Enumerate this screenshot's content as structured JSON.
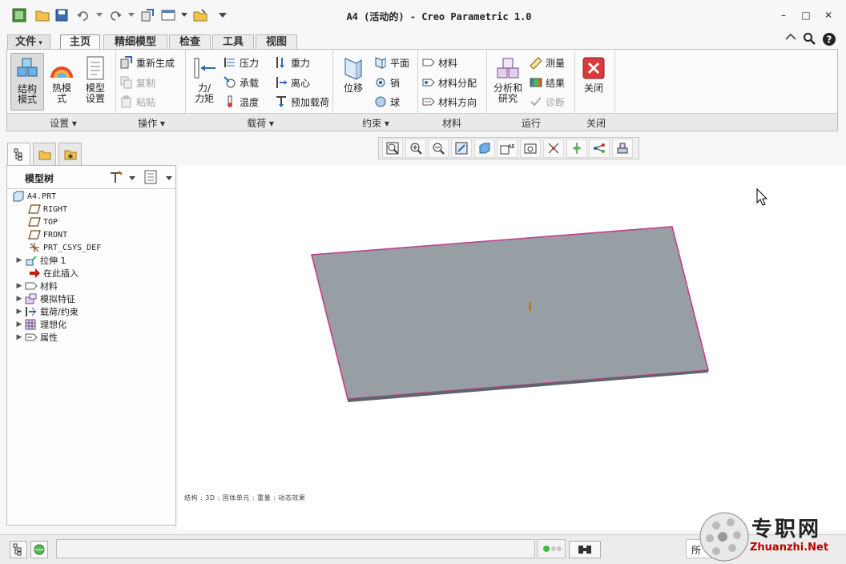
{
  "window": {
    "title": "A4 (活动的) - Creo Parametric 1.0",
    "controls": [
      "–",
      "□",
      "✕"
    ]
  },
  "quick_access": {
    "icons": [
      "app-icon",
      "open-icon",
      "save-icon",
      "undo-icon",
      "redo-icon",
      "regenerate-icon",
      "windows-icon",
      "close-window-icon",
      "customize-icon"
    ]
  },
  "tabs": [
    {
      "label": "文件",
      "has_dropdown": true
    },
    {
      "label": "主页",
      "active": true
    },
    {
      "label": "精细模型"
    },
    {
      "label": "检查"
    },
    {
      "label": "工具"
    },
    {
      "label": "视图"
    }
  ],
  "ribbon": {
    "groups": {
      "setup": "设置",
      "operations": "操作",
      "loads": "载荷",
      "constraints": "约束",
      "materials": "材料",
      "run": "运行",
      "close": "关闭"
    },
    "setup": {
      "structure_mode": "结构\n模式",
      "thermal_mode": "热模\n式",
      "model_setup": "模型\n设置"
    },
    "operations": {
      "regenerate": "重新生成",
      "copy": "复制",
      "paste": "粘贴"
    },
    "loads": {
      "force_moment": "力/\n力矩",
      "pressure": "压力",
      "bearing": "承载",
      "temperature": "温度",
      "gravity": "重力",
      "centrifugal": "离心",
      "preload": "预加载荷"
    },
    "constraints": {
      "displacement": "位移",
      "planar": "平面",
      "pin": "销",
      "ball": "球"
    },
    "materials": {
      "material": "材料",
      "material_assignment": "材料分配",
      "material_orientation": "材料方向"
    },
    "run": {
      "analysis": "分析和\n研究",
      "measure": "测量",
      "results": "结果",
      "diagnostics": "诊断"
    },
    "close": {
      "close": "关闭"
    }
  },
  "model_tree": {
    "title": "模型树",
    "items": [
      {
        "label": "A4.PRT",
        "icon": "part-icon",
        "level": 0
      },
      {
        "label": "RIGHT",
        "icon": "datum-plane-icon",
        "level": 1
      },
      {
        "label": "TOP",
        "icon": "datum-plane-icon",
        "level": 1
      },
      {
        "label": "FRONT",
        "icon": "datum-plane-icon",
        "level": 1
      },
      {
        "label": "PRT_CSYS_DEF",
        "icon": "csys-icon",
        "level": 1
      },
      {
        "label": "拉伸 1",
        "icon": "extrude-icon",
        "level": 1,
        "expandable": true
      },
      {
        "label": "在此插入",
        "icon": "insert-arrow-icon",
        "level": 1
      },
      {
        "label": "材料",
        "icon": "material-icon",
        "level": 1,
        "expandable": true
      },
      {
        "label": "模拟特征",
        "icon": "sim-feature-icon",
        "level": 1,
        "expandable": true
      },
      {
        "label": "载荷/约束",
        "icon": "load-constraint-icon",
        "level": 1,
        "expandable": true
      },
      {
        "label": "理想化",
        "icon": "idealization-icon",
        "level": 1,
        "expandable": true
      },
      {
        "label": "属性",
        "icon": "property-icon",
        "level": 1,
        "expandable": true
      }
    ]
  },
  "graphics_toolbar": {
    "icons": [
      "refit-icon",
      "zoom-in-icon",
      "zoom-out-icon",
      "repaint-icon",
      "display-style-icon",
      "saved-views-icon",
      "view-manager-icon",
      "datum-display-icon",
      "spin-center-icon",
      "annotation-icon",
      "simulation-display-icon"
    ]
  },
  "graphics": {
    "status_line": "结构 : 3D : 固体单元 : 重量 : 动态效果"
  },
  "status_bar": {
    "partial_text": "所",
    "icons": [
      "model-tree-toggle-icon",
      "browser-toggle-icon",
      "regen-status-icon",
      "selection-filter-icon"
    ]
  },
  "watermark": {
    "cn": "专职网",
    "en": "Zhuanzhi.Net"
  },
  "colors": {
    "plate_fill": "#979ea4",
    "plate_edge": "#c0408c",
    "close_red": "#d83b3b"
  }
}
